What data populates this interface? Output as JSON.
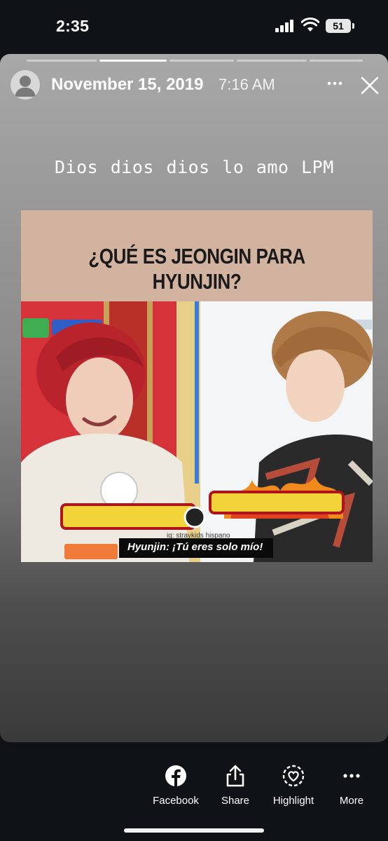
{
  "status_bar": {
    "time": "2:35",
    "battery": "51"
  },
  "story": {
    "date": "November 15, 2019",
    "time": "7:16 AM",
    "caption": "Dios dios dios lo amo LPM",
    "meme": {
      "title": "¿QUÉ ES JEONGIN PARA HYUNJIN?",
      "subtitle": "Hyunjin: ¡Tú eres solo mío!",
      "watermark": "ig: straykids hispano"
    }
  },
  "actions": [
    {
      "label": "Facebook",
      "icon": "facebook-icon"
    },
    {
      "label": "Share",
      "icon": "share-icon"
    },
    {
      "label": "Highlight",
      "icon": "highlight-icon"
    },
    {
      "label": "More",
      "icon": "more-icon"
    }
  ],
  "colors": {
    "background": "#0f1217",
    "meme_header": "#d2b3a0"
  }
}
